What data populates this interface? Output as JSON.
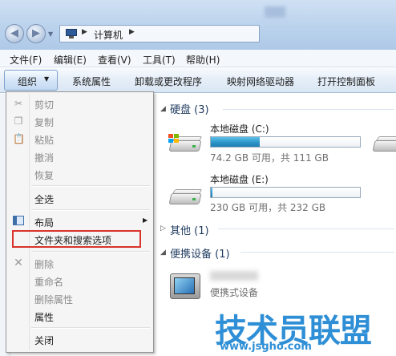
{
  "address": {
    "location": "计算机"
  },
  "menubar": [
    "文件(F)",
    "编辑(E)",
    "查看(V)",
    "工具(T)",
    "帮助(H)"
  ],
  "toolbar": {
    "organize": "组织",
    "items": [
      "系统属性",
      "卸载或更改程序",
      "映射网络驱动器",
      "打开控制面板"
    ]
  },
  "dropdown": {
    "items": [
      {
        "label": "剪切",
        "enabled": false,
        "icon": "scissors-icon"
      },
      {
        "label": "复制",
        "enabled": false,
        "icon": "copy-icon"
      },
      {
        "label": "粘贴",
        "enabled": false,
        "icon": "paste-icon"
      },
      {
        "label": "撤消",
        "enabled": false
      },
      {
        "label": "恢复",
        "enabled": false
      },
      {
        "label": "全选",
        "enabled": true
      },
      {
        "label": "布局",
        "enabled": true,
        "icon": "layout-icon",
        "submenu": true
      },
      {
        "label": "文件夹和搜索选项",
        "enabled": true,
        "highlighted": true
      },
      {
        "label": "删除",
        "enabled": false,
        "icon": "delete-x-icon"
      },
      {
        "label": "重命名",
        "enabled": false
      },
      {
        "label": "删除属性",
        "enabled": false
      },
      {
        "label": "属性",
        "enabled": true
      },
      {
        "label": "关闭",
        "enabled": true
      }
    ]
  },
  "groups": {
    "harddisk": {
      "title": "硬盘 (3)"
    },
    "other": {
      "title": "其他 (1)"
    },
    "portable": {
      "title": "便携设备 (1)"
    }
  },
  "drives": [
    {
      "name": "本地磁盘 (C:)",
      "info": "74.2 GB 可用，共 111 GB",
      "used_fraction": 0.33
    },
    {
      "name": "本地磁盘 (E:)",
      "info": "230 GB 可用，共 232 GB",
      "used_fraction": 0.01
    }
  ],
  "device": {
    "label": "便携式设备"
  },
  "watermark": {
    "main": "技术员联盟",
    "sub": "www.jsgho.com"
  },
  "colors": {
    "highlight_border": "#d9342b",
    "bar_fill": "#2a91c6",
    "watermark": "#2f8fd6"
  }
}
